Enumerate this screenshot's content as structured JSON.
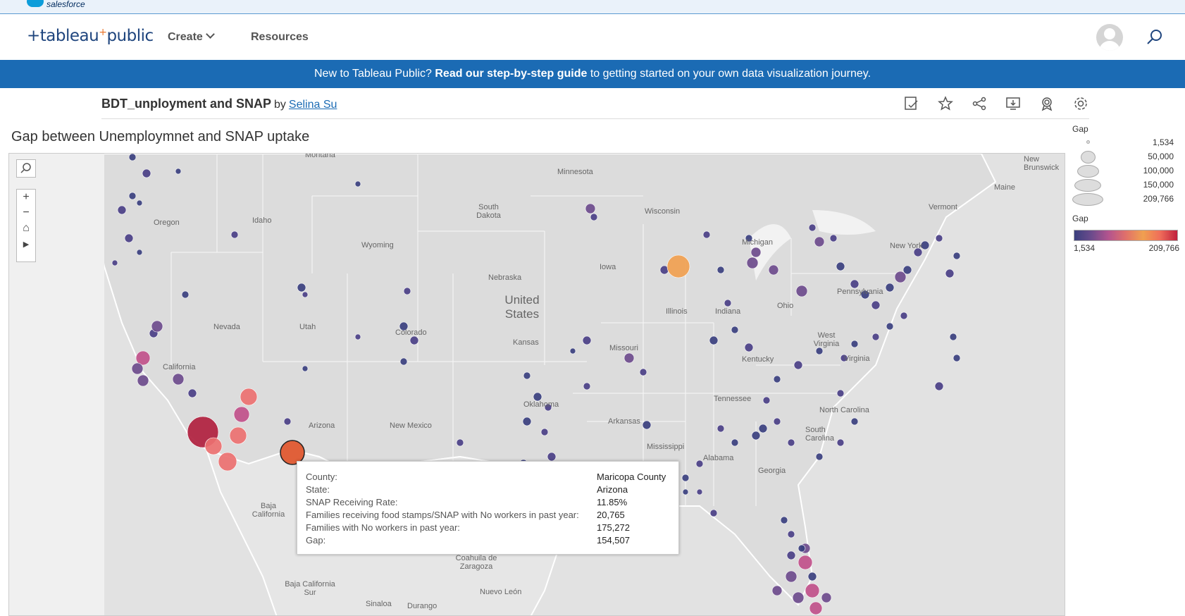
{
  "salesforce": {
    "label": "salesforce"
  },
  "nav": {
    "logo": "+tableau+public",
    "create_label": "Create",
    "resources_label": "Resources"
  },
  "banner": {
    "prefix": "New to Tableau Public?",
    "link_text": "Read our step-by-step guide",
    "suffix": "to getting started on your own data visualization journey."
  },
  "viz": {
    "name": "BDT_unployment and SNAP",
    "by": "by",
    "author": "Selina Su",
    "sheet_title": "Gap between Unemploymnet and SNAP uptake"
  },
  "map": {
    "labels": [
      {
        "text": "Montana"
      },
      {
        "text": "Minnesota"
      },
      {
        "text": "Oregon"
      },
      {
        "text": "Idaho"
      },
      {
        "text": "South Dakota"
      },
      {
        "text": "Wisconsin"
      },
      {
        "text": "Wyoming"
      },
      {
        "text": "Nebraska"
      },
      {
        "text": "Iowa"
      },
      {
        "text": "Michigan"
      },
      {
        "text": "Nevada"
      },
      {
        "text": "Utah"
      },
      {
        "text": "Colorado"
      },
      {
        "text": "Kansas"
      },
      {
        "text": "Missouri"
      },
      {
        "text": "Illinois"
      },
      {
        "text": "Indiana"
      },
      {
        "text": "California"
      },
      {
        "text": "Arizona"
      },
      {
        "text": "New Mexico"
      },
      {
        "text": "Oklahoma"
      },
      {
        "text": "Arkansas"
      },
      {
        "text": "Tennessee"
      },
      {
        "text": "Kentucky"
      },
      {
        "text": "West Virginia"
      },
      {
        "text": "Virginia"
      },
      {
        "text": "Pennsylvania"
      },
      {
        "text": "New York"
      },
      {
        "text": "Vermont"
      },
      {
        "text": "Maine"
      },
      {
        "text": "New Brunswick"
      },
      {
        "text": "Ohio"
      },
      {
        "text": "Mississippi"
      },
      {
        "text": "Alabama"
      },
      {
        "text": "Georgia"
      },
      {
        "text": "South Carolina"
      },
      {
        "text": "North Carolina"
      },
      {
        "text": "Baja California"
      },
      {
        "text": "Baja California Sur"
      },
      {
        "text": "Sinaloa"
      },
      {
        "text": "Durango"
      },
      {
        "text": "Nuevo León"
      },
      {
        "text": "Coahuila de Zaragoza"
      }
    ],
    "country_label": "United States"
  },
  "tooltip": {
    "rows": [
      {
        "label": "County:",
        "value": "Maricopa County"
      },
      {
        "label": "State:",
        "value": "Arizona"
      },
      {
        "label": "SNAP Receiving Rate:",
        "value": "11.85%"
      },
      {
        "label": "Families receiving food stamps/SNAP with No workers in past year:",
        "value": "20,765"
      },
      {
        "label": "Families with No workers in past year:",
        "value": "175,272"
      },
      {
        "label": "Gap:",
        "value": "154,507"
      }
    ]
  },
  "legend": {
    "size_title": "Gap",
    "sizes": [
      "1,534",
      "50,000",
      "100,000",
      "150,000",
      "209,766"
    ],
    "color_title": "Gap",
    "color_min": "1,534",
    "color_max": "209,766"
  },
  "colors": {
    "brand_blue": "#1b6bb4",
    "low": "#3a3f7e",
    "high": "#c0203e"
  }
}
